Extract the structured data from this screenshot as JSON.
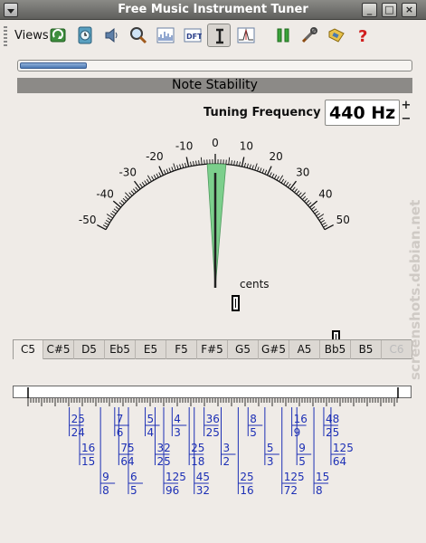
{
  "window": {
    "title": "Free Music Instrument Tuner",
    "buttons": [
      "_",
      "□",
      "×"
    ]
  },
  "toolbar": {
    "views_label": "Views",
    "icons": [
      "refresh-icon",
      "clock-icon",
      "speaker-icon",
      "magnifier-icon",
      "spectrum-icon",
      "dft-icon",
      "tuner-icon",
      "waveform-icon",
      "pause-icon",
      "tools-icon",
      "folder-icon",
      "help-icon"
    ],
    "dft_text": "DFT"
  },
  "progress": {
    "fraction": 0.17
  },
  "stability": {
    "label": "Note Stability"
  },
  "tuning": {
    "label": "Tuning Frequency",
    "value": "440 Hz",
    "up": "+",
    "down": "−"
  },
  "gauge": {
    "tick_labels": [
      "-50",
      "-40",
      "-30",
      "-20",
      "-10",
      "0",
      "10",
      "20",
      "30",
      "40",
      "50"
    ],
    "needle_cents": 0,
    "error_band_cents": [
      -3,
      4
    ],
    "band_color": "#7ccf8c",
    "cents_label": "cents"
  },
  "notes": {
    "items": [
      "C5",
      "C#5",
      "D5",
      "Eb5",
      "E5",
      "F5",
      "F#5",
      "G5",
      "G#5",
      "A5",
      "Bb5",
      "B5",
      "C6"
    ],
    "active": "C5"
  },
  "ratios": {
    "color": "#1c2fb5",
    "items": [
      {
        "n": "25",
        "d": "24",
        "pos": 0.07,
        "row": 0
      },
      {
        "n": "16",
        "d": "15",
        "pos": 0.113,
        "row": 1
      },
      {
        "n": "9",
        "d": "8",
        "pos": 0.2,
        "row": 2
      },
      {
        "n": "7",
        "d": "6",
        "pos": 0.259,
        "row": 0
      },
      {
        "n": "75",
        "d": "64",
        "pos": 0.276,
        "row": 1
      },
      {
        "n": "6",
        "d": "5",
        "pos": 0.316,
        "row": 2
      },
      {
        "n": "5",
        "d": "4",
        "pos": 0.386,
        "row": 0
      },
      {
        "n": "32",
        "d": "25",
        "pos": 0.427,
        "row": 1
      },
      {
        "n": "125",
        "d": "96",
        "pos": 0.463,
        "row": 2
      },
      {
        "n": "4",
        "d": "3",
        "pos": 0.498,
        "row": 0
      },
      {
        "n": "25",
        "d": "18",
        "pos": 0.569,
        "row": 1
      },
      {
        "n": "45",
        "d": "32",
        "pos": 0.59,
        "row": 2
      },
      {
        "n": "36",
        "d": "25",
        "pos": 0.631,
        "row": 0
      },
      {
        "n": "3",
        "d": "2",
        "pos": 0.702,
        "row": 1
      },
      {
        "n": "25",
        "d": "16",
        "pos": 0.773,
        "row": 2
      },
      {
        "n": "8",
        "d": "5",
        "pos": 0.814,
        "row": 0
      },
      {
        "n": "5",
        "d": "3",
        "pos": 0.884,
        "row": 1
      },
      {
        "n": "125",
        "d": "72",
        "pos": 0.955,
        "row": 2
      },
      {
        "n": "16",
        "d": "9",
        "pos": 0.996,
        "row": 0
      },
      {
        "n": "9",
        "d": "5",
        "pos": 1.017,
        "row": 1
      },
      {
        "n": "15",
        "d": "8",
        "pos": 1.088,
        "row": 2
      },
      {
        "n": "48",
        "d": "25",
        "pos": 1.129,
        "row": 0
      },
      {
        "n": "125",
        "d": "64",
        "pos": 1.159,
        "row": 1
      }
    ]
  },
  "watermark": {
    "text": "screenshots.debian.net"
  }
}
